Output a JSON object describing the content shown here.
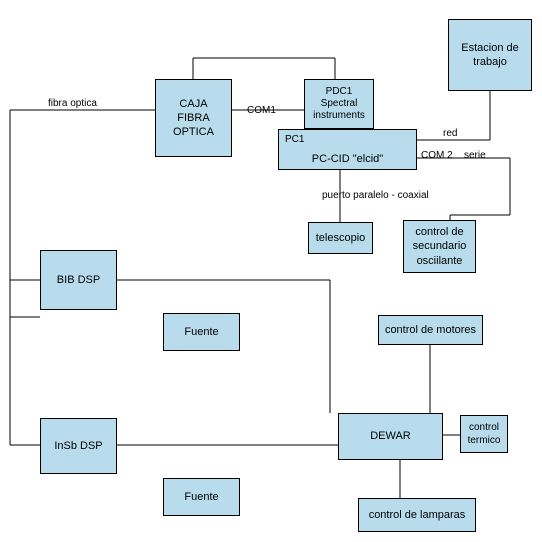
{
  "boxes": {
    "estacion": "Estacion de\ntrabajo",
    "caja": "CAJA\nFIBRA\nOPTICA",
    "pdc1_top": "PDC1",
    "pdc1_mid": "Spectral",
    "pdc1_bot": "instruments",
    "pc1_top": "PC1",
    "pc1_bot": "PC-CID \"elcid\"",
    "telescopio": "telescopio",
    "secundario": "control de\nsecundario\nosciilante",
    "bib": "BIB DSP",
    "insb": "InSb DSP",
    "fuente1": "Fuente",
    "fuente2": "Fuente",
    "motores": "control de motores",
    "dewar": "DEWAR",
    "termico": "control\ntermico",
    "lamparas": "control de lamparas"
  },
  "labels": {
    "fibra": "fibra optica",
    "com1": "COM1",
    "red": "red",
    "com2": "COM 2",
    "serie": "serie",
    "puerto": "puerto paralelo - coaxial"
  }
}
